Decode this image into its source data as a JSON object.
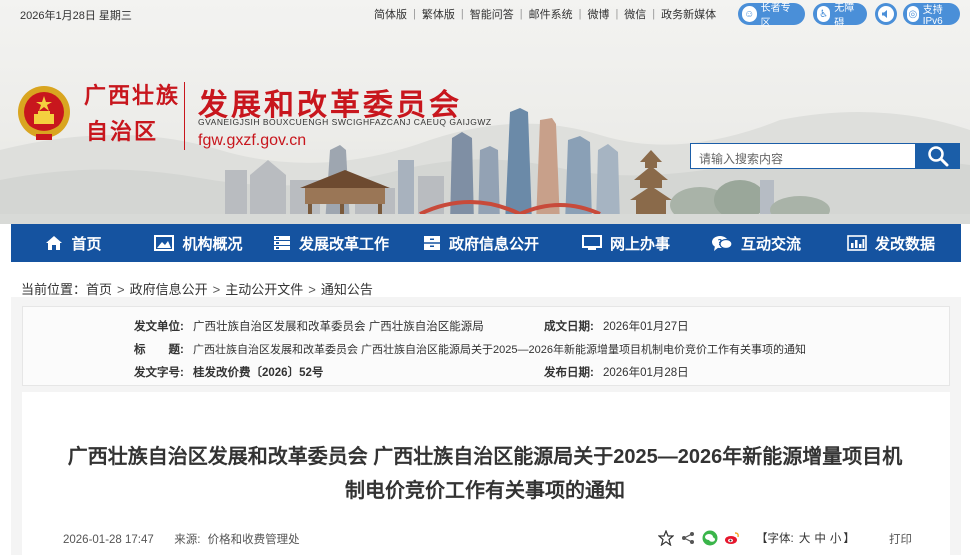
{
  "topbar": {
    "date": "2026年1月28日  星期三",
    "links": [
      "简体版",
      "繁体版",
      "智能问答",
      "邮件系统",
      "微博",
      "微信",
      "政务新媒体"
    ],
    "pills": [
      {
        "label": "长者专区",
        "icon": "elder-icon"
      },
      {
        "label": "无障碍",
        "icon": "accessibility-icon"
      },
      {
        "label": "支持IPv6",
        "icon": "ipv6-icon"
      }
    ]
  },
  "logo": {
    "region_line1": "广西壮族",
    "region_line2": "自治区",
    "agency_name": "发展和改革委员会",
    "agency_pinyin": "GVANEIGJSIH BOUXCUENGH SWCIGHFAZCANJ CAEUQ GAIJGWZ",
    "domain": "fgw.gxzf.gov.cn"
  },
  "search": {
    "placeholder": "请输入搜索内容"
  },
  "nav": [
    {
      "label": "首页",
      "icon": "home-icon"
    },
    {
      "label": "机构概况",
      "icon": "image-icon"
    },
    {
      "label": "发展改革工作",
      "icon": "server-icon"
    },
    {
      "label": "政府信息公开",
      "icon": "cabinet-icon"
    },
    {
      "label": "网上办事",
      "icon": "monitor-icon"
    },
    {
      "label": "互动交流",
      "icon": "chat-icon"
    },
    {
      "label": "发改数据",
      "icon": "bar-chart-icon"
    }
  ],
  "breadcrumb": {
    "prefix": "当前位置：",
    "items": [
      "首页",
      "政府信息公开",
      "主动公开文件",
      "通知公告"
    ]
  },
  "meta": {
    "issuer_label": "发文单位:",
    "issuer": "广西壮族自治区发展和改革委员会 广西壮族自治区能源局",
    "date_label": "成文日期:",
    "date": "2026年01月27日",
    "title_label": "标　　题:",
    "title": "广西壮族自治区发展和改革委员会 广西壮族自治区能源局关于2025—2026年新能源增量项目机制电价竞价工作有关事项的通知",
    "docno_label": "发文字号:",
    "docno": "桂发改价费〔2026〕52号",
    "publish_label": "发布日期:",
    "publish": "2026年01月28日"
  },
  "article": {
    "title": "广西壮族自治区发展和改革委员会 广西壮族自治区能源局关于2025—2026年新能源增量项目机制电价竞价工作有关事项的通知",
    "datetime": "2026-01-28 17:47",
    "source_label": "来源:",
    "source": "价格和收费管理处",
    "font_prefix": "【字体:",
    "font_sizes": [
      "大",
      "中",
      "小"
    ],
    "font_suffix": "】",
    "print": "打印"
  },
  "colors": {
    "brand_red": "#c8161d",
    "nav_blue": "#1553a0",
    "pill_blue": "#4a8fd8"
  }
}
